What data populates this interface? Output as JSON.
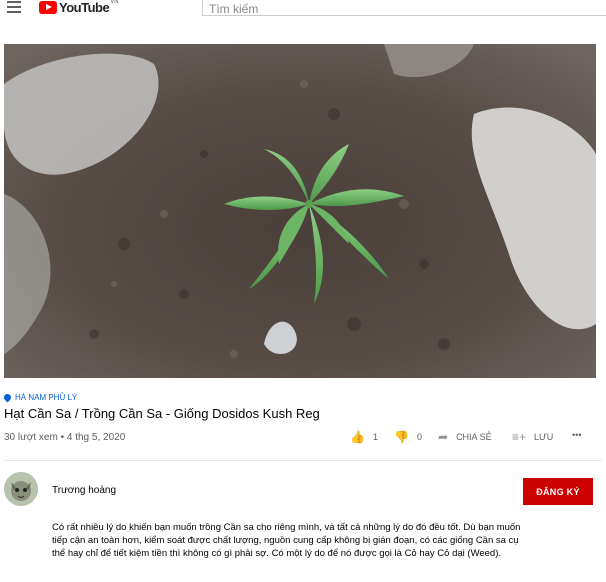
{
  "header": {
    "logo_text": "YouTube",
    "region_code": "VN",
    "search_placeholder": "Tìm kiếm",
    "icons": {
      "menu": "hamburger-icon",
      "logo": "youtube-logo-icon"
    },
    "colors": {
      "brand": "#ff0000"
    }
  },
  "video": {
    "location": "HÀ NAM PHỦ LÝ",
    "title": "Hạt Cần Sa / Trồng Cần Sa - Giống Dosidos Kush Reg",
    "meta": "30 lượt xem • 4 thg 5, 2020",
    "actions": {
      "like_count": "1",
      "dislike_count": "0",
      "share_label": "CHIA SẺ",
      "save_label": "LƯU",
      "more_label": "•••"
    }
  },
  "channel": {
    "name": "Trương hoàng",
    "subscribe_label": "ĐĂNG KÝ",
    "colors": {
      "subscribe": "#cc0000"
    }
  },
  "description": {
    "text": "Có rất nhiều lý do khiến bạn muốn trồng Cần sa cho riêng mình, và tất cả những lý do đó đều tốt. Dù bạn muốn tiếp cận an toàn hơn, kiểm soát được chất lượng, nguồn cung cấp không bị gián đoạn, có các giống Cần sa cụ thể hay chỉ để tiết kiệm tiền thì không có gì phải sợ. Có một lý do để nó được gọi là Cỏ hay Cỏ dại (Weed)."
  }
}
